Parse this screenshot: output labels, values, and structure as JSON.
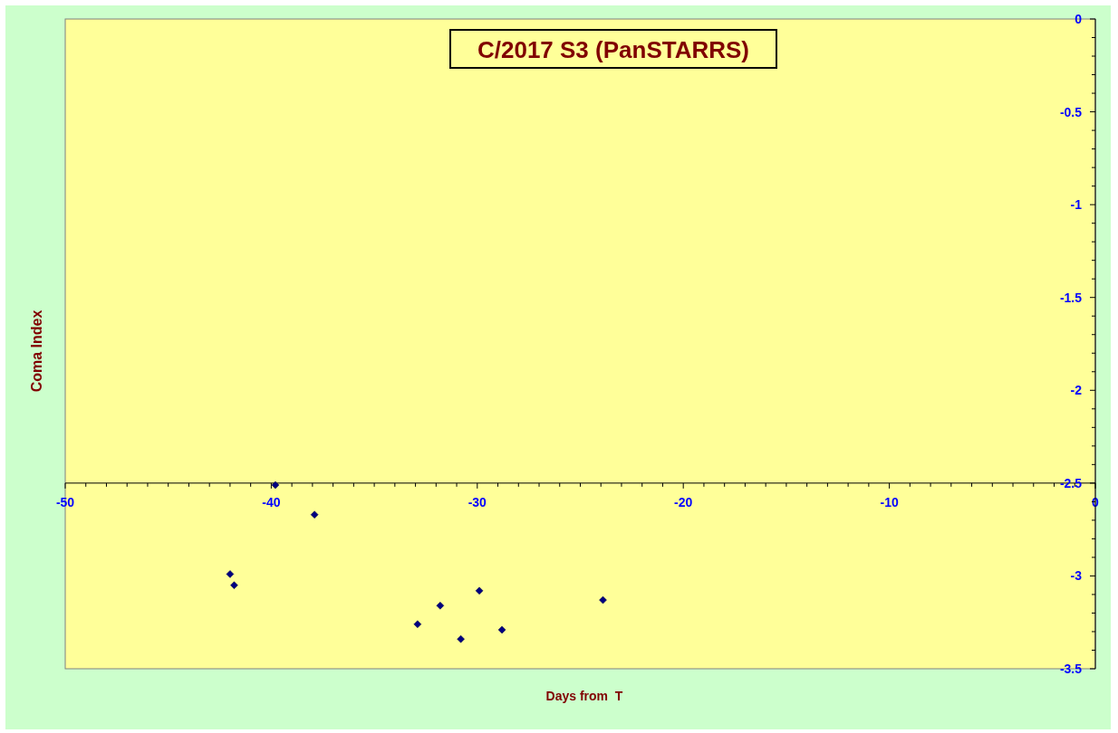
{
  "chart_data": {
    "type": "scatter",
    "title": "C/2017 S3 (PanSTARRS)",
    "xlabel": "Days from  T",
    "ylabel": "Coma Index",
    "x": [
      -42.0,
      -41.8,
      -39.8,
      -37.9,
      -32.9,
      -31.8,
      -30.8,
      -29.9,
      -28.8,
      -23.9
    ],
    "series": [
      {
        "color": "#000080",
        "values": [
          -2.99,
          -3.05,
          -2.51,
          -2.67,
          -3.26,
          -3.16,
          -3.34,
          -3.08,
          -3.29,
          -3.13
        ]
      }
    ],
    "xlim": [
      -50,
      0
    ],
    "ylim": [
      -3.5,
      0
    ],
    "xticks": [
      -50,
      -40,
      -30,
      -20,
      -10,
      0
    ],
    "yticks": [
      0,
      -0.5,
      -1,
      -1.5,
      -2,
      -2.5,
      -3,
      -3.5
    ]
  }
}
